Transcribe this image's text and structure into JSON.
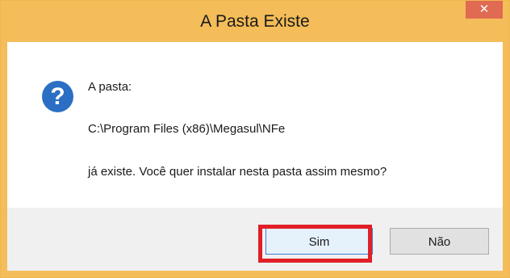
{
  "window": {
    "title": "A Pasta Existe",
    "close_label": "✕"
  },
  "message": {
    "line1": "A pasta:",
    "line2": "C:\\Program Files (x86)\\Megasul\\NFe",
    "line3": "já existe. Você quer instalar nesta pasta assim mesmo?"
  },
  "icon": {
    "name": "question-icon",
    "glyph": "?"
  },
  "buttons": {
    "yes_label": "Sim",
    "no_label": "Não"
  },
  "colors": {
    "titlebar": "#f4bd59",
    "close_button": "#e06a52",
    "icon": "#2a6fc4",
    "highlight": "#e01f26"
  }
}
